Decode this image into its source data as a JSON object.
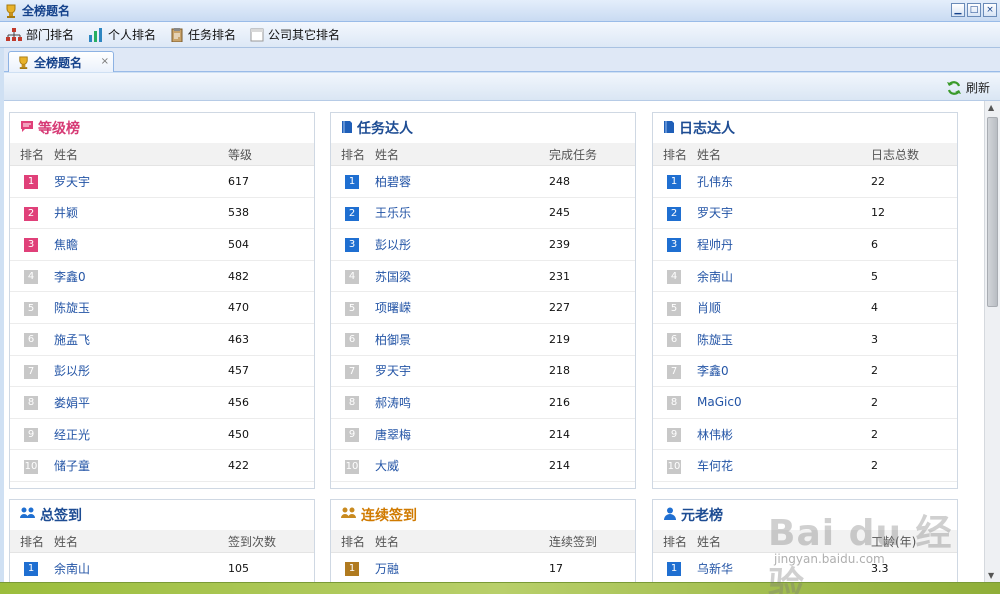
{
  "window": {
    "title": "全榜题名"
  },
  "menu": [
    {
      "label": "部门排名",
      "icon": "org-chart-icon"
    },
    {
      "label": "个人排名",
      "icon": "bar-chart-icon"
    },
    {
      "label": "任务排名",
      "icon": "clipboard-icon"
    },
    {
      "label": "公司其它排名",
      "icon": "document-icon"
    }
  ],
  "tab": {
    "label": "全榜题名",
    "close": "×"
  },
  "toolbar": {
    "refresh_label": "刷新"
  },
  "colors": {
    "pink": "#e04079",
    "blue": "#1f6fd1",
    "gray": "#c8c8c8",
    "brown": "#b07a1f"
  },
  "panels": [
    {
      "title": "等级榜",
      "icon": "speech-bubble-icon",
      "title_color": "pink",
      "headers": [
        "排名",
        "姓名",
        "等级"
      ],
      "rows": [
        {
          "rank": "1",
          "name": "罗天宇",
          "value": "617",
          "badge": "pink"
        },
        {
          "rank": "2",
          "name": "井颖",
          "value": "538",
          "badge": "pink"
        },
        {
          "rank": "3",
          "name": "焦瞻",
          "value": "504",
          "badge": "pink"
        },
        {
          "rank": "4",
          "name": "李鑫0",
          "value": "482",
          "badge": "gray"
        },
        {
          "rank": "5",
          "name": "陈旋玉",
          "value": "470",
          "badge": "gray"
        },
        {
          "rank": "6",
          "name": "施孟飞",
          "value": "463",
          "badge": "gray"
        },
        {
          "rank": "7",
          "name": "彭以彤",
          "value": "457",
          "badge": "gray"
        },
        {
          "rank": "8",
          "name": "娄娟平",
          "value": "456",
          "badge": "gray"
        },
        {
          "rank": "9",
          "name": "经正光",
          "value": "450",
          "badge": "gray"
        },
        {
          "rank": "10",
          "name": "储子童",
          "value": "422",
          "badge": "gray"
        }
      ]
    },
    {
      "title": "任务达人",
      "icon": "book-icon",
      "title_color": "blue",
      "headers": [
        "排名",
        "姓名",
        "完成任务"
      ],
      "rows": [
        {
          "rank": "1",
          "name": "柏碧蓉",
          "value": "248",
          "badge": "blue"
        },
        {
          "rank": "2",
          "name": "王乐乐",
          "value": "245",
          "badge": "blue"
        },
        {
          "rank": "3",
          "name": "彭以彤",
          "value": "239",
          "badge": "blue"
        },
        {
          "rank": "4",
          "name": "苏国梁",
          "value": "231",
          "badge": "gray"
        },
        {
          "rank": "5",
          "name": "项曙嵘",
          "value": "227",
          "badge": "gray"
        },
        {
          "rank": "6",
          "name": "柏御景",
          "value": "219",
          "badge": "gray"
        },
        {
          "rank": "7",
          "name": "罗天宇",
          "value": "218",
          "badge": "gray"
        },
        {
          "rank": "8",
          "name": "郝涛鸣",
          "value": "216",
          "badge": "gray"
        },
        {
          "rank": "9",
          "name": "唐翠梅",
          "value": "214",
          "badge": "gray"
        },
        {
          "rank": "10",
          "name": "大威",
          "value": "214",
          "badge": "gray"
        }
      ]
    },
    {
      "title": "日志达人",
      "icon": "book-icon",
      "title_color": "blue",
      "headers": [
        "排名",
        "姓名",
        "日志总数"
      ],
      "rows": [
        {
          "rank": "1",
          "name": "孔伟东",
          "value": "22",
          "badge": "blue"
        },
        {
          "rank": "2",
          "name": "罗天宇",
          "value": "12",
          "badge": "blue"
        },
        {
          "rank": "3",
          "name": "程帅丹",
          "value": "6",
          "badge": "blue"
        },
        {
          "rank": "4",
          "name": "余南山",
          "value": "5",
          "badge": "gray"
        },
        {
          "rank": "5",
          "name": "肖顺",
          "value": "4",
          "badge": "gray"
        },
        {
          "rank": "6",
          "name": "陈旋玉",
          "value": "3",
          "badge": "gray"
        },
        {
          "rank": "7",
          "name": "李鑫0",
          "value": "2",
          "badge": "gray"
        },
        {
          "rank": "8",
          "name": "MaGic0",
          "value": "2",
          "badge": "gray"
        },
        {
          "rank": "9",
          "name": "林伟彬",
          "value": "2",
          "badge": "gray"
        },
        {
          "rank": "10",
          "name": "车何花",
          "value": "2",
          "badge": "gray"
        }
      ]
    },
    {
      "title": "总签到",
      "icon": "people-icon",
      "title_color": "blue",
      "headers": [
        "排名",
        "姓名",
        "签到次数"
      ],
      "rows": [
        {
          "rank": "1",
          "name": "余南山",
          "value": "105",
          "badge": "blue"
        }
      ]
    },
    {
      "title": "连续签到",
      "icon": "people-icon",
      "title_color": "orange",
      "headers": [
        "排名",
        "姓名",
        "连续签到"
      ],
      "rows": [
        {
          "rank": "1",
          "name": "万融",
          "value": "17",
          "badge": "brown"
        }
      ]
    },
    {
      "title": "元老榜",
      "icon": "user-group-icon",
      "title_color": "blue",
      "headers": [
        "排名",
        "姓名",
        "工龄(年)"
      ],
      "rows": [
        {
          "rank": "1",
          "name": "乌新华",
          "value": "3.3",
          "badge": "blue"
        }
      ]
    }
  ],
  "watermark": {
    "logo": "Bai du 经验",
    "url": "jingyan.baidu.com"
  }
}
